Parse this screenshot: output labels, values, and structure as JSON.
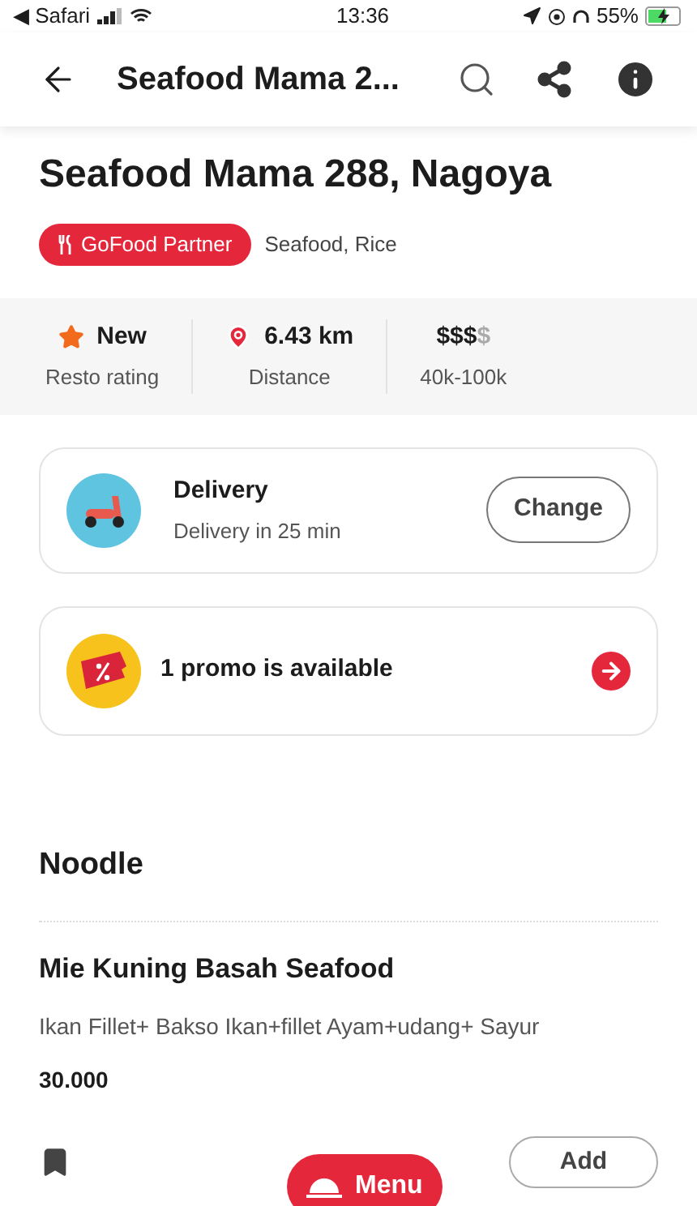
{
  "status_bar": {
    "back_app": "◀ Safari",
    "time": "13:36",
    "battery": "55%"
  },
  "nav": {
    "title": "Seafood Mama 2..."
  },
  "restaurant": {
    "name": "Seafood Mama 288, Nagoya",
    "badge": "GoFood Partner",
    "cuisine": "Seafood, Rice"
  },
  "stats": [
    {
      "kind": "rating",
      "value": "New",
      "label": "Resto rating"
    },
    {
      "kind": "distance",
      "value": "6.43 km",
      "label": "Distance"
    },
    {
      "kind": "price",
      "value": "$$$",
      "value_dim": "$",
      "label": "40k-100k"
    }
  ],
  "delivery": {
    "title": "Delivery",
    "subtitle": "Delivery in 25 min",
    "button": "Change"
  },
  "promo": {
    "text": "1 promo is available"
  },
  "section": {
    "title": "Noodle"
  },
  "items": [
    {
      "name": "Mie Kuning Basah Seafood",
      "description": "Ikan Fillet+ Bakso Ikan+fillet Ayam+udang+ Sayur",
      "price": "30.000",
      "button": "Add"
    }
  ],
  "menu_button": "Menu"
}
